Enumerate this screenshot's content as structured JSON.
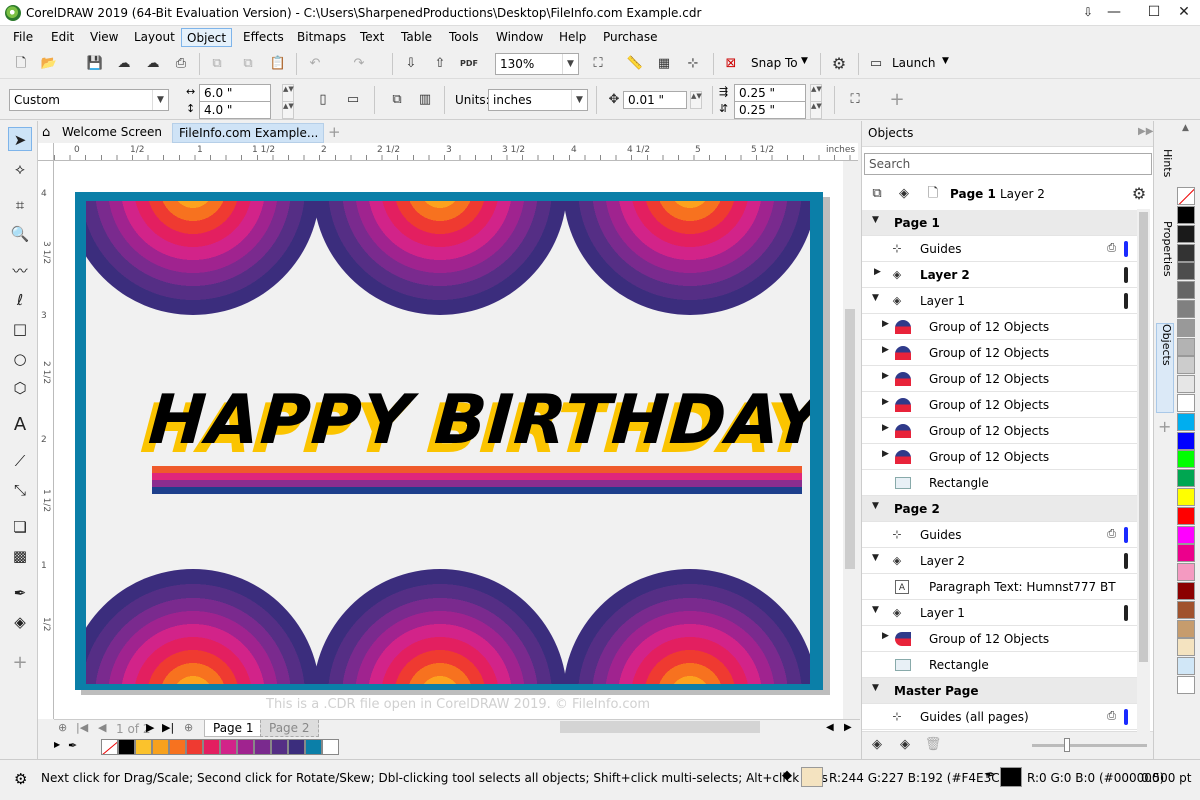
{
  "window": {
    "title": "CorelDRAW 2019 (64-Bit Evaluation Version) - C:\\Users\\SharpenedProductions\\Desktop\\FileInfo.com Example.cdr"
  },
  "menu": [
    "File",
    "Edit",
    "View",
    "Layout",
    "Object",
    "Effects",
    "Bitmaps",
    "Text",
    "Table",
    "Tools",
    "Window",
    "Help",
    "Purchase"
  ],
  "toolbar": {
    "zoom": "130%",
    "snap_to": "Snap To",
    "launch": "Launch"
  },
  "property_bar": {
    "preset": "Custom",
    "width": "6.0 \"",
    "height": "4.0 \"",
    "units_label": "Units:",
    "units": "inches",
    "nudge": "0.01 \"",
    "dup_x": "0.25 \"",
    "dup_y": "0.25 \""
  },
  "doc_tabs": {
    "welcome": "Welcome Screen",
    "file": "FileInfo.com Example..."
  },
  "ruler": {
    "unit": "inches",
    "h_labels": [
      "0",
      "1/2",
      "1",
      "1 1/2",
      "2",
      "2 1/2",
      "3",
      "3 1/2",
      "4",
      "4 1/2",
      "5",
      "5 1/2"
    ],
    "v_labels": [
      "4",
      "3 1/2",
      "3",
      "2 1/2",
      "2",
      "1 1/2",
      "1",
      "1/2"
    ]
  },
  "canvas": {
    "headline1": "HAPPY",
    "headline2": "BIRTHDAY",
    "stripe_colors": [
      "#ef5a2b",
      "#e0267a",
      "#8b2d8f",
      "#1d3f8c"
    ],
    "accent": "#0b7fa8",
    "shadow_color": "#fbc400"
  },
  "watermark": "This is a .CDR file open in CorelDRAW 2019. © FileInfo.com",
  "page_nav": {
    "of_label": "1 of 2",
    "page1": "Page 1",
    "page2": "Page 2"
  },
  "palette_colors": [
    "#000000",
    "#fbc22c",
    "#f7a11d",
    "#f7721f",
    "#ef3a31",
    "#e31f60",
    "#d22389",
    "#a0238f",
    "#7a2a8e",
    "#552e85",
    "#3b2d7d",
    "#0b7fa8",
    "#ffffff"
  ],
  "status": {
    "hint": "Next click for Drag/Scale; Second click for Rotate/Skew; Dbl-clicking tool selects all objects; Shift+click multi-selects; Alt+click digs",
    "fill_info": "R:244 G:227 B:192 (#F4E3C0)",
    "fill_color": "#F4E3C0",
    "outline_info": "R:0 G:0 B:0 (#000000)",
    "outline_width": "0.500 pt"
  },
  "objects_panel": {
    "title": "Objects",
    "search_placeholder": "Search",
    "current_page": "Page 1",
    "current_layer": "Layer 2",
    "rows": [
      {
        "text": "Page 1",
        "kind": "page"
      },
      {
        "text": "Guides",
        "kind": "guides"
      },
      {
        "text": "Layer 2",
        "kind": "layer-bold"
      },
      {
        "text": "Layer 1",
        "kind": "layer"
      },
      {
        "text": "Group of 12 Objects",
        "kind": "group"
      },
      {
        "text": "Group of 12 Objects",
        "kind": "group"
      },
      {
        "text": "Group of 12 Objects",
        "kind": "group"
      },
      {
        "text": "Group of 12 Objects",
        "kind": "group"
      },
      {
        "text": "Group of 12 Objects",
        "kind": "group"
      },
      {
        "text": "Group of 12 Objects",
        "kind": "group"
      },
      {
        "text": "Rectangle",
        "kind": "rect"
      },
      {
        "text": "Page 2",
        "kind": "page"
      },
      {
        "text": "Guides",
        "kind": "guides"
      },
      {
        "text": "Layer 2",
        "kind": "layer"
      },
      {
        "text": "Paragraph Text: Humnst777 BT",
        "kind": "text"
      },
      {
        "text": "Layer 1",
        "kind": "layer"
      },
      {
        "text": "Group of 12 Objects",
        "kind": "group"
      },
      {
        "text": "Rectangle",
        "kind": "rect"
      },
      {
        "text": "Master Page",
        "kind": "page"
      },
      {
        "text": "Guides (all pages)",
        "kind": "guides"
      }
    ]
  },
  "docker_tabs": [
    "Hints",
    "Properties",
    "Objects"
  ],
  "color_palette": [
    "#000000",
    "#1a1a1a",
    "#333333",
    "#4d4d4d",
    "#666666",
    "#808080",
    "#999999",
    "#b3b3b3",
    "#cccccc",
    "#e6e6e6",
    "#ffffff",
    "#00aeef",
    "#0000ff",
    "#00ff00",
    "#00a651",
    "#ffff00",
    "#ff0000",
    "#ff00ff",
    "#ec008c",
    "#f49ac1",
    "#8b0000",
    "#a0522d",
    "#c69c6d",
    "#f4e3c0",
    "#d1e7f7",
    "#ffffff"
  ]
}
